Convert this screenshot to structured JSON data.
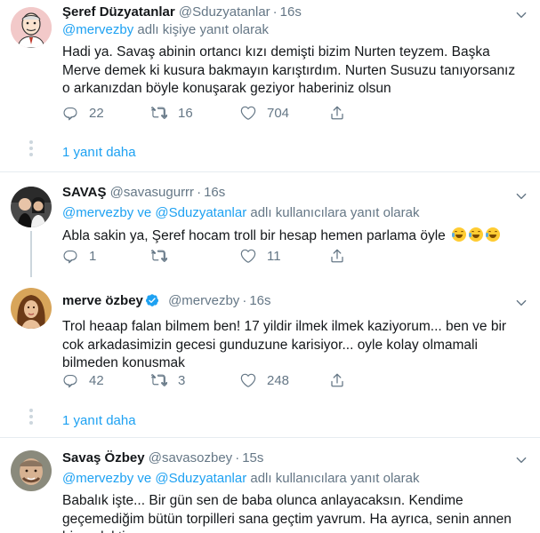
{
  "tweets": [
    {
      "name": "Şeref Düzyatanlar",
      "handle": "@Sduzyatanlar",
      "time": "16s",
      "reply_mention": "@mervezby",
      "reply_suffix": " adlı kişiye yanıt olarak",
      "text": "Hadi ya. Savaş abinin ortancı kızı demişti bizim Nurten teyzem. Başka Merve demek ki kusura bakmayın karıştırdım. Nurten Susuzu tanıyorsanız o arkanızdan böyle konuşarak geziyor haberiniz olsun",
      "replies": "22",
      "retweets": "16",
      "likes": "704",
      "more_replies": "1 yanıt daha"
    },
    {
      "name": "SAVAŞ",
      "handle": "@savasugurrr",
      "time": "16s",
      "reply_mention": "@mervezby ve @Sduzyatanlar",
      "reply_suffix": " adlı kullanıcılara yanıt olarak",
      "text": "Abla sakin ya, Şeref hocam troll bir hesap hemen parlama öyle",
      "replies": "1",
      "retweets": "",
      "likes": "11"
    },
    {
      "name": "merve özbey",
      "handle": "@mervezby",
      "time": "16s",
      "text": "Trol heaap falan bilmem ben! 17 yildir ilmek ilmek kaziyorum... ben ve bir cok arkadasimizin gecesi gunduzune karisiyor... oyle kolay olmamali bilmeden konusmak",
      "replies": "42",
      "retweets": "3",
      "likes": "248",
      "more_replies": "1 yanıt daha"
    },
    {
      "name": "Savaş Özbey",
      "handle": "@savasozbey",
      "time": "15s",
      "reply_mention": "@mervezby ve @Sduzyatanlar",
      "reply_suffix": " adlı kullanıcılara yanıt olarak",
      "text": "Babalık işte... Bir gün sen de baba olunca anlayacaksın. Kendime geçemediğim bütün torpilleri sana geçtim yavrum. Ha ayrıca, senin annen bir melekti.."
    }
  ],
  "separator": "·",
  "colors": {
    "accent": "#1da1f2",
    "muted": "#657786",
    "divider": "#e6ecf0",
    "verified": "#1da1f2"
  },
  "icons": [
    "reply-icon",
    "retweet-icon",
    "like-icon",
    "share-icon",
    "chevron-down-icon",
    "verified-badge-icon",
    "tears-of-joy-emoji"
  ]
}
